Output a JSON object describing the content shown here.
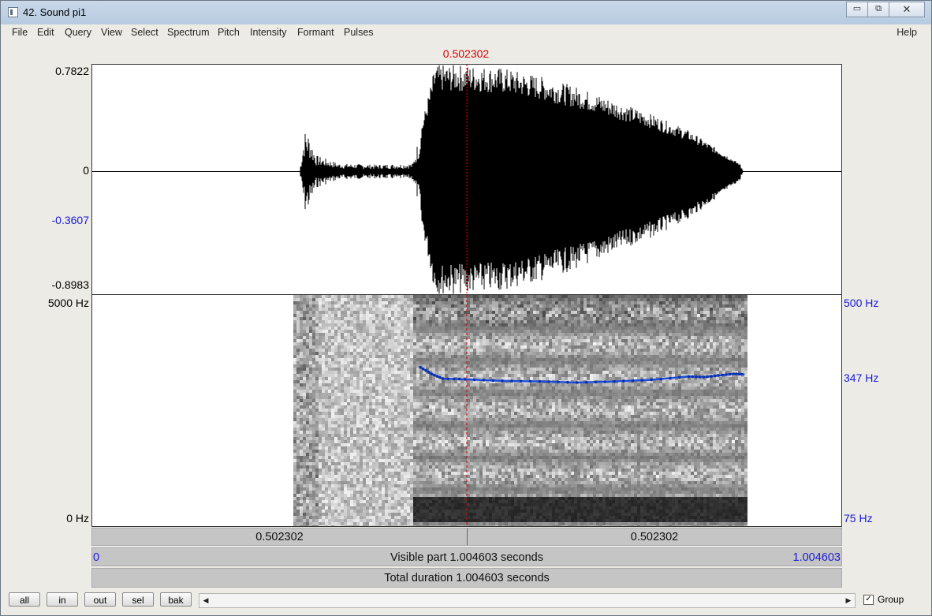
{
  "window": {
    "title": "42. Sound pi1",
    "buttons": {
      "minimize": "▭",
      "maximize": "⧉",
      "close": "✕"
    }
  },
  "menu": {
    "items": [
      "File",
      "Edit",
      "Query",
      "View",
      "Select",
      "Spectrum",
      "Pitch",
      "Intensity",
      "Formant",
      "Pulses"
    ],
    "help": "Help"
  },
  "cursor": {
    "time_label": "0.502302",
    "time": 0.502302,
    "color": "#dd0000"
  },
  "waveform": {
    "y_max": "0.7822",
    "y_zero": "0",
    "y_cursor": "-0.3607",
    "y_min": "-0.8983",
    "range": [
      -0.8983,
      0.7822
    ],
    "envelope": {
      "t": [
        0,
        0.278,
        0.28,
        0.285,
        0.29,
        0.3,
        0.33,
        0.38,
        0.43,
        0.44,
        0.46,
        0.5,
        0.55,
        0.6,
        0.65,
        0.7,
        0.75,
        0.8,
        0.84,
        0.87,
        0.874,
        1.004603
      ],
      "amplitude": [
        0,
        0,
        0.08,
        0.3,
        0.28,
        0.12,
        0.06,
        0.05,
        0.06,
        0.3,
        0.78,
        0.78,
        0.76,
        0.7,
        0.62,
        0.52,
        0.42,
        0.3,
        0.16,
        0.05,
        0,
        0
      ]
    }
  },
  "spectrogram": {
    "freq_top": "5000 Hz",
    "freq_bottom": "0 Hz",
    "pitch_top": "500 Hz",
    "pitch_value": "347 Hz",
    "pitch_bottom": "75 Hz",
    "pitch_color": "#1f4fd8",
    "pitch_range_hz": [
      75,
      500
    ],
    "pitch_track": {
      "t": [
        0.44,
        0.455,
        0.47,
        0.5,
        0.55,
        0.6,
        0.65,
        0.7,
        0.75,
        0.8,
        0.82,
        0.84,
        0.86,
        0.875
      ],
      "hz": [
        367,
        355,
        346,
        345,
        342,
        341,
        339,
        341,
        344,
        350,
        349,
        352,
        355,
        354
      ]
    }
  },
  "time_bar": {
    "left_value": "0.502302",
    "right_value": "0.502302"
  },
  "visible_bar": {
    "start": "0",
    "label": "Visible part 1.004603 seconds",
    "end": "1.004603"
  },
  "total_bar": {
    "label": "Total duration 1.004603 seconds"
  },
  "controls": {
    "buttons": [
      "all",
      "in",
      "out",
      "sel",
      "bak"
    ],
    "group_label": "Group",
    "group_checked": true,
    "check_mark": "✓",
    "scroll_left": "◀",
    "scroll_right": "▶"
  },
  "duration": 1.004603
}
